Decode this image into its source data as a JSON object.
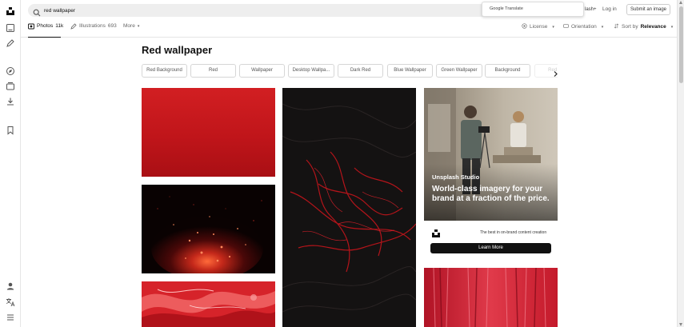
{
  "search": {
    "query": "red wallpaper"
  },
  "popup": {
    "text": "Google Translate"
  },
  "header": {
    "plus_partial": "lash+",
    "login": "Log in",
    "submit": "Submit an image"
  },
  "tabs": {
    "photos": {
      "label": "Photos",
      "count": "11k"
    },
    "illustrations": {
      "label": "Illustrations",
      "count": "693"
    },
    "more": "More"
  },
  "filters": {
    "license": "License",
    "orientation": "Orientation",
    "sort_prefix": "Sort by",
    "sort_value": "Relevance"
  },
  "page_title": "Red wallpaper",
  "chips": [
    "Red Background",
    "Red",
    "Wallpaper",
    "Desktop Wallpa...",
    "Dark Red",
    "Blue Wallpaper",
    "Green Wallpaper",
    "Background",
    "Red Fl..."
  ],
  "promo": {
    "brand": "Unsplash Studio",
    "headline": "World-class imagery for your brand at a fraction of the price.",
    "tagline": "The best in on-brand content creation",
    "cta": "Learn More"
  },
  "rail_icons": [
    "unsplash-logo-icon",
    "home-icon",
    "pen-icon",
    "compass-icon",
    "collections-icon",
    "download-icon",
    "bookmark-icon",
    "user-icon",
    "translate-icon",
    "menu-icon"
  ],
  "colors": {
    "accent": "#111111",
    "red": "#c8151a"
  }
}
